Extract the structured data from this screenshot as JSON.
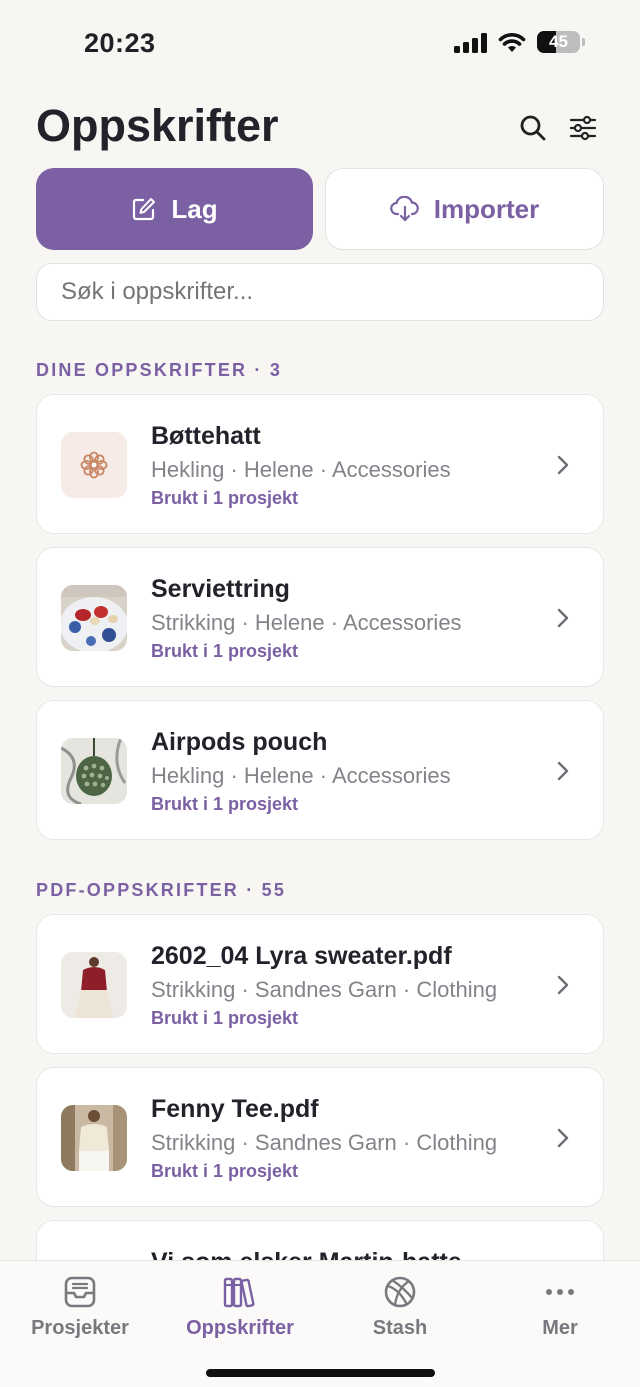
{
  "status": {
    "time": "20:23",
    "battery": "45",
    "battery_level": 0.45
  },
  "header": {
    "title": "Oppskrifter",
    "search_icon": "search-icon",
    "filter_icon": "sliders-icon"
  },
  "actions": {
    "create_label": "Lag",
    "import_label": "Importer"
  },
  "search": {
    "placeholder": "Søk i oppskrifter..."
  },
  "sections": {
    "mine": {
      "title": "DINE OPPSKRIFTER · 3",
      "items": [
        {
          "title": "Bøttehatt",
          "meta": "Hekling · Helene · Accessories",
          "usage": "Brukt i 1 prosjekt"
        },
        {
          "title": "Serviettring",
          "meta": "Strikking · Helene · Accessories",
          "usage": "Brukt i 1 prosjekt"
        },
        {
          "title": "Airpods pouch",
          "meta": "Hekling · Helene · Accessories",
          "usage": "Brukt i 1 prosjekt"
        }
      ]
    },
    "pdf": {
      "title": "PDF-OPPSKRIFTER · 55",
      "items": [
        {
          "title": "2602_04 Lyra sweater.pdf",
          "meta": "Strikking · Sandnes Garn · Clothing",
          "usage": "Brukt i 1 prosjekt"
        },
        {
          "title": "Fenny Tee.pdf",
          "meta": "Strikking · Sandnes Garn · Clothing",
          "usage": "Brukt i 1 prosjekt"
        },
        {
          "title": "Vi som elsker Martin-hatte",
          "meta": "",
          "usage": ""
        }
      ]
    }
  },
  "tabs": [
    {
      "label": "Prosjekter",
      "icon": "tray-icon"
    },
    {
      "label": "Oppskrifter",
      "icon": "books-icon",
      "active": true
    },
    {
      "label": "Stash",
      "icon": "yarn-ball-icon"
    },
    {
      "label": "Mer",
      "icon": "more-icon"
    }
  ],
  "colors": {
    "accent": "#7b60a3",
    "background": "#f7f6f3"
  }
}
